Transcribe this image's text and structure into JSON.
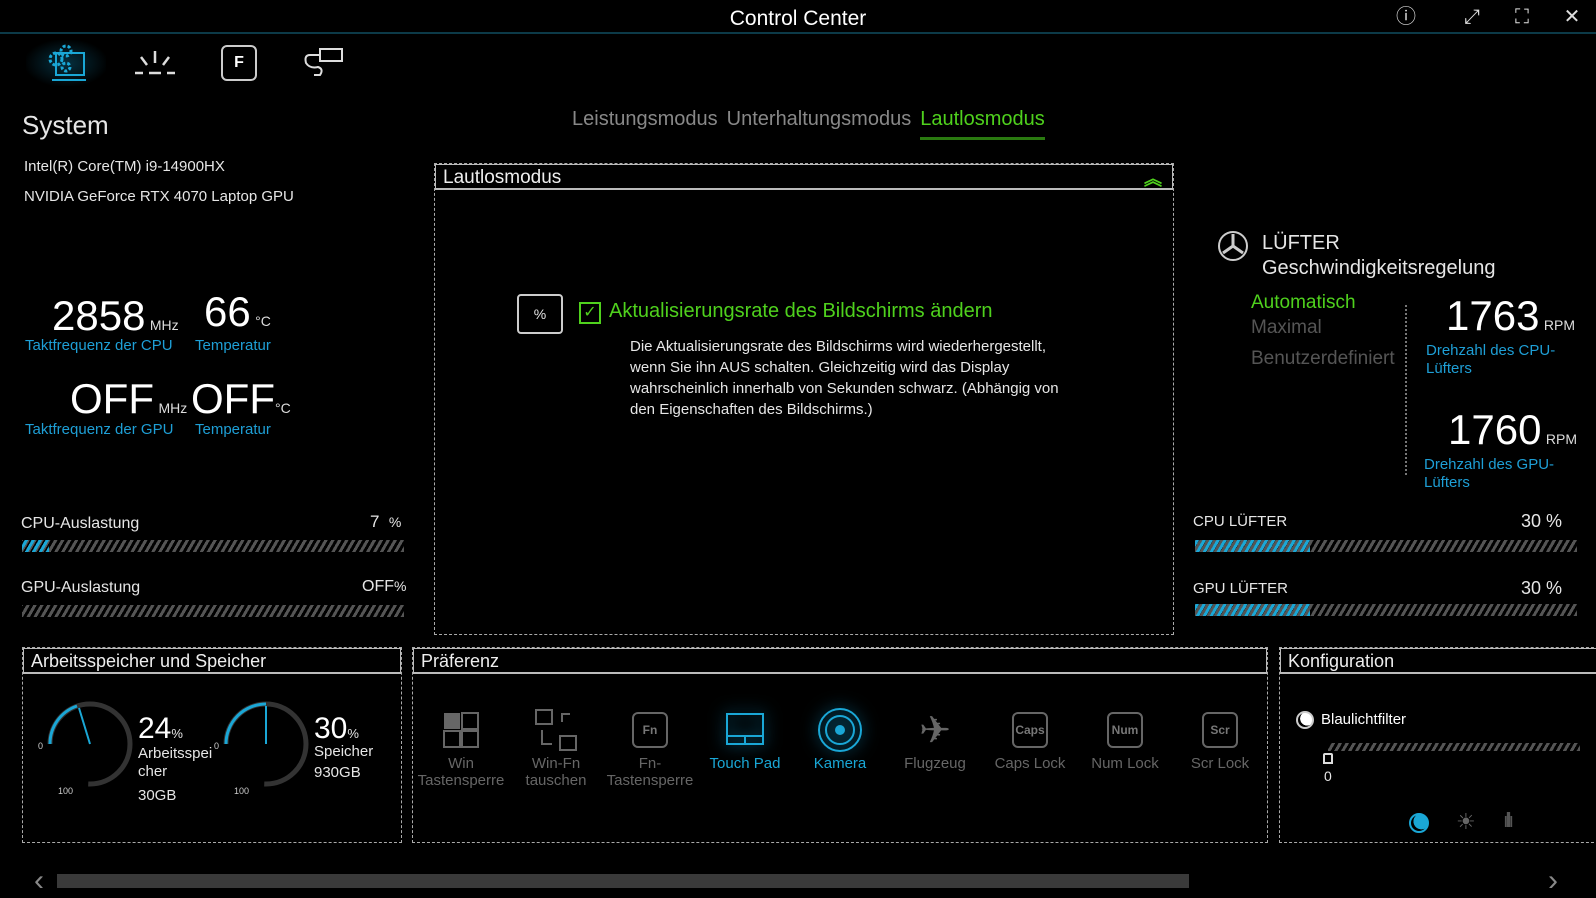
{
  "window": {
    "title": "Control Center",
    "buttons": [
      "info-icon",
      "restore-icon",
      "fullscreen-icon",
      "close-icon"
    ]
  },
  "nav": [
    "system-icon",
    "lighting-icon",
    "function-key-icon",
    "power-icon"
  ],
  "system": {
    "heading": "System",
    "cpu_name": "Intel(R) Core(TM) i9-14900HX",
    "gpu_name": "NVIDIA GeForce RTX 4070 Laptop GPU",
    "cpu_freq": "2858",
    "cpu_freq_unit": "MHz",
    "cpu_freq_label": "Taktfrequenz der CPU",
    "cpu_temp": "66",
    "temp_unit": "°C",
    "temp_label": "Temperatur",
    "gpu_freq": "OFF",
    "gpu_freq_unit": "MHz",
    "gpu_freq_label": "Taktfrequenz der GPU",
    "gpu_temp": "OFF",
    "gpu_temp_label": "Temperatur",
    "cpu_load_label": "CPU-Auslastung",
    "cpu_load": "7",
    "cpu_load_pct": 7,
    "gpu_load_label": "GPU-Auslastung",
    "gpu_load": "OFF",
    "gpu_load_pct": 0,
    "pct": "%"
  },
  "modes": {
    "tabs": [
      "Leistungsmodus",
      "Unterhaltungsmodus",
      "Lautlosmodus"
    ],
    "active": 2,
    "accent": "#4fd11d"
  },
  "panel": {
    "title": "Lautlosmodus",
    "option_label": "Aktualisierungsrate des Bildschirms ändern",
    "checked": true,
    "description": "Die Aktualisierungsrate des Bildschirms wird wiederhergestellt, wenn Sie ihn AUS schalten. Gleichzeitig wird das Display wahrscheinlich innerhalb von Sekunden schwarz. (Abhängig von den Eigenschaften des Bildschirms.)"
  },
  "fan": {
    "title1": "LÜFTER",
    "title2": "Geschwindigkeitsregelung",
    "options": [
      "Automatisch",
      "Maximal",
      "Benutzerdefiniert"
    ],
    "active": 0,
    "cpu_rpm": "1763",
    "gpu_rpm": "1760",
    "rpm_unit": "RPM",
    "cpu_rpm_label": "Drehzahl des CPU-Lüfters",
    "gpu_rpm_label": "Drehzahl des GPU-Lüfters",
    "cpu_fan_label": "CPU LÜFTER",
    "cpu_fan": "30 %",
    "cpu_fan_pct": 30,
    "gpu_fan_label": "GPU LÜFTER",
    "gpu_fan": "30 %",
    "gpu_fan_pct": 30
  },
  "memory": {
    "title": "Arbeitsspeicher und Speicher",
    "ram_pct": "24",
    "ram_label": "Arbeitsspeicher",
    "ram_size": "30GB",
    "disk_pct": "30",
    "disk_label": "Speicher",
    "disk_size": "930GB",
    "scale_min": "0",
    "scale_max": "100",
    "pct": "%"
  },
  "preferences": {
    "title": "Präferenz",
    "items": [
      {
        "label": "Win Tastensperre",
        "on": false
      },
      {
        "label": "Win-Fn tauschen",
        "on": false
      },
      {
        "label": "Fn-Tastensperre",
        "on": false
      },
      {
        "label": "Touch Pad",
        "on": true
      },
      {
        "label": "Kamera",
        "on": true
      },
      {
        "label": "Flugzeug",
        "on": false
      },
      {
        "label": "Caps Lock",
        "on": false,
        "key": "Caps"
      },
      {
        "label": "Num Lock",
        "on": false,
        "key": "Num"
      },
      {
        "label": "Scr Lock",
        "on": false,
        "key": "Scr"
      }
    ]
  },
  "config": {
    "title": "Konfiguration",
    "blue_light_label": "Blaulichtfilter",
    "blue_light_value": "0",
    "tabs": [
      "blue-light-icon",
      "brightness-icon",
      "audio-icon"
    ],
    "active_tab": 0
  },
  "accent_blue": "#1aa7d6"
}
